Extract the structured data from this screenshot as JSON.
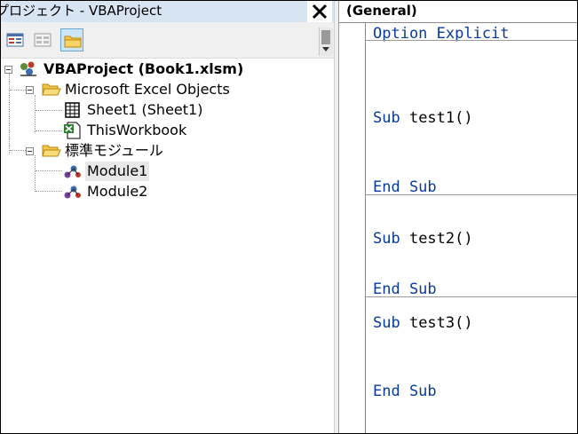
{
  "project_window": {
    "title": "プロジェクト - VBAProject",
    "close_glyph": "✕",
    "toolbar": [
      {
        "name": "view-code-button",
        "icon": "view-code-icon"
      },
      {
        "name": "view-object-button",
        "icon": "view-object-icon"
      },
      {
        "name": "toggle-folders-button",
        "icon": "folder-icon",
        "active": true
      }
    ],
    "tree": {
      "project": "VBAProject (Book1.xlsm)",
      "excel_objects_folder": "Microsoft Excel Objects",
      "sheet1": "Sheet1 (Sheet1)",
      "this_workbook": "ThisWorkbook",
      "modules_folder": "標準モジュール",
      "module1": "Module1",
      "module2": "Module2",
      "selected": "Module1"
    }
  },
  "code_window": {
    "object_combo": "(General)",
    "lines": {
      "option": {
        "kw": "Option Explicit",
        "ident": ""
      },
      "sub1": {
        "kw": "Sub ",
        "ident": "test1()"
      },
      "end1": {
        "kw": "End Sub",
        "ident": ""
      },
      "sub2": {
        "kw": "Sub ",
        "ident": "test2()"
      },
      "end2": {
        "kw": "End Sub",
        "ident": ""
      },
      "sub3": {
        "kw": "Sub ",
        "ident": "test3()"
      },
      "end3": {
        "kw": "End Sub",
        "ident": ""
      }
    }
  },
  "colors": {
    "keyword": "#0a3aa0",
    "title_bar": "#d7e4f2",
    "selection": "#e8e8e8"
  }
}
